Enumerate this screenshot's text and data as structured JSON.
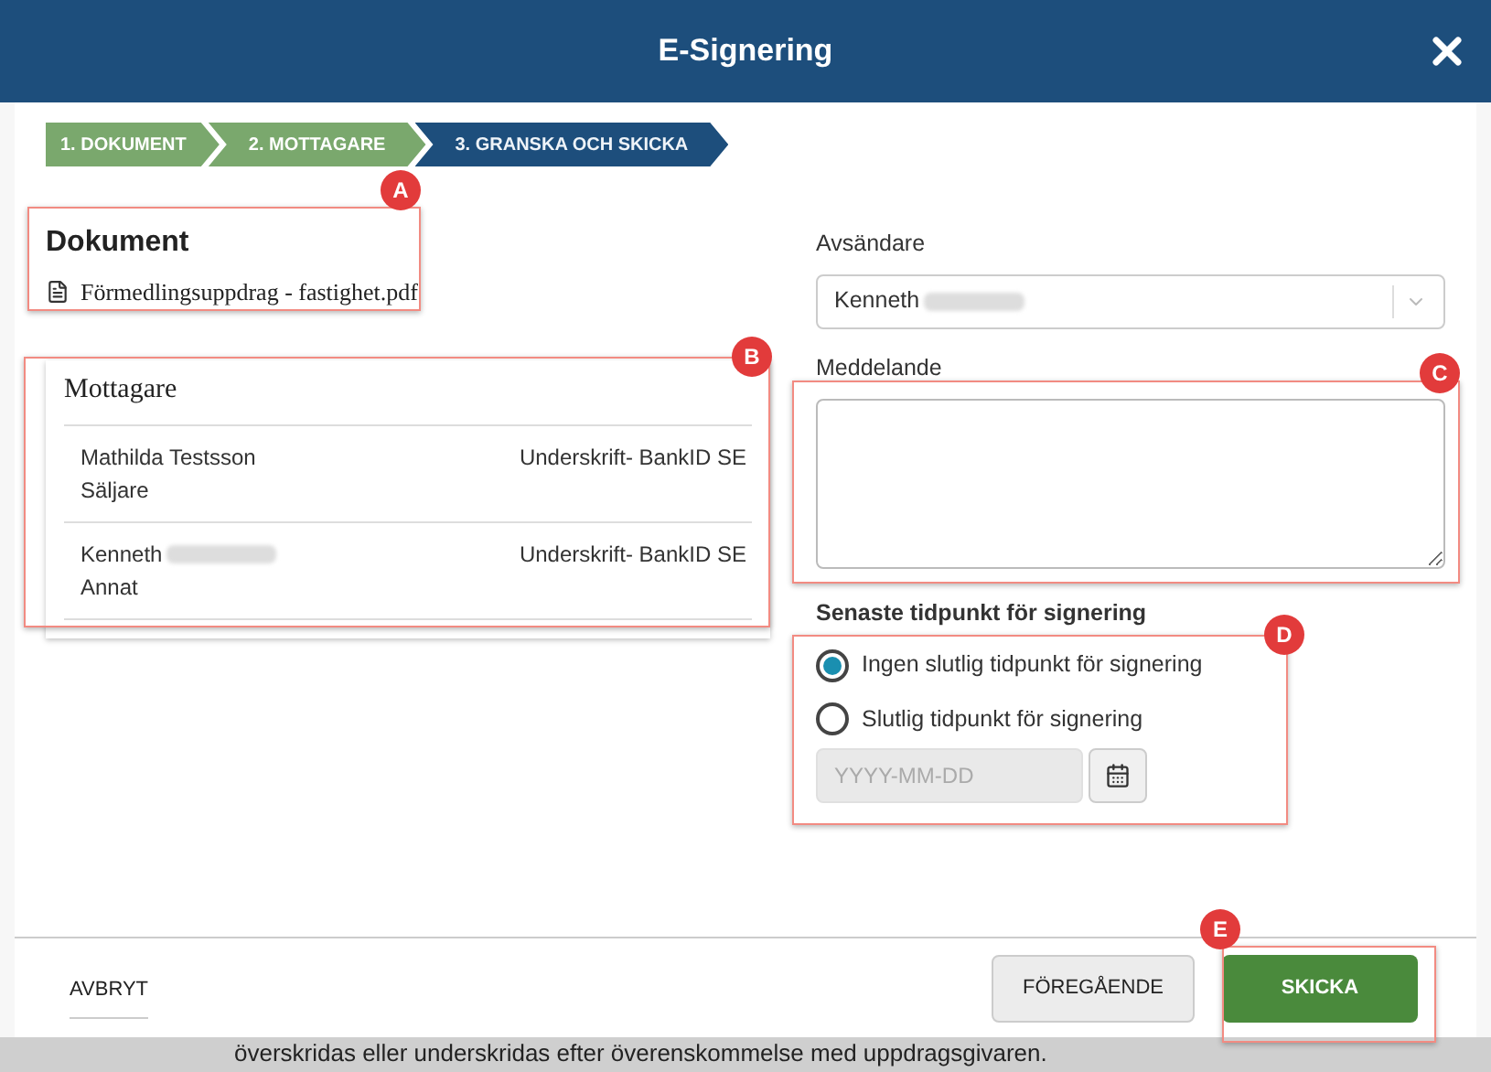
{
  "dialog": {
    "title": "E-Signering"
  },
  "steps": [
    {
      "label": "1. DOKUMENT",
      "completed": true,
      "selected": false
    },
    {
      "label": "2. MOTTAGARE",
      "completed": true,
      "selected": false
    },
    {
      "label": "3. GRANSKA OCH SKICKA",
      "completed": false,
      "selected": true
    }
  ],
  "document": {
    "heading": "Dokument",
    "file": "Förmedlingsuppdrag - fastighet.pdf"
  },
  "recipients": {
    "heading": "Mottagare",
    "rows": [
      {
        "name": "Mathilda Testsson",
        "redacted": false,
        "role": "Säljare",
        "method": "Underskrift- BankID SE"
      },
      {
        "name": "Kenneth",
        "redacted": true,
        "role": "Annat",
        "method": "Underskrift- BankID SE"
      }
    ]
  },
  "sender": {
    "label": "Avsändare",
    "value": "Kenneth",
    "redacted": true
  },
  "message": {
    "label": "Meddelande"
  },
  "deadline": {
    "label": "Senaste tidpunkt för signering",
    "options": [
      {
        "label": "Ingen slutlig tidpunkt för signering",
        "selected": true
      },
      {
        "label": "Slutlig tidpunkt för signering",
        "selected": false
      }
    ],
    "date": {
      "placeholder": "YYYY-MM-DD",
      "disabled": true
    }
  },
  "footer": {
    "cancel": "AVBRYT",
    "back": "FÖREGÅENDE",
    "submit": "SKICKA"
  },
  "annotations": [
    {
      "label": "A"
    },
    {
      "label": "B"
    },
    {
      "label": "C"
    },
    {
      "label": "D"
    },
    {
      "label": "E"
    }
  ],
  "backdrop_text": "överskridas eller underskridas efter överenskommelse med uppdragsgivaren."
}
